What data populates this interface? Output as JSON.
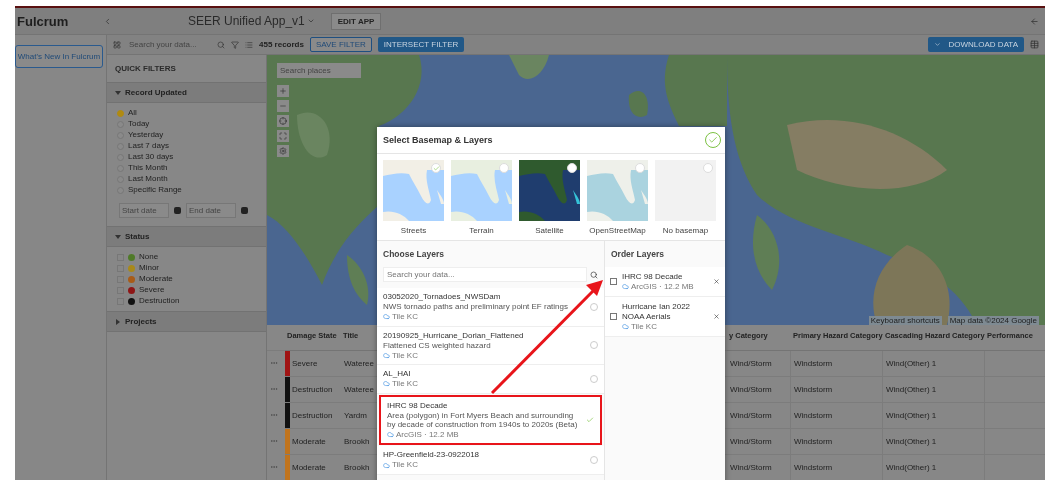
{
  "header": {
    "brand": "Fulcrum",
    "app_title": "SEER Unified App_v1",
    "edit_button": "EDIT APP"
  },
  "sidebar": {
    "whats_new_button": "What's New In Fulcrum"
  },
  "toolbar": {
    "search": {
      "placeholder": "Search your data..."
    },
    "record_count": "455 records",
    "save_filter_button": "SAVE FILTER",
    "intersect_button": "INTERSECT FILTER",
    "download_button": "DOWNLOAD DATA"
  },
  "filters": {
    "title": "QUICK FILTERS",
    "record_updated": {
      "title": "Record Updated",
      "expanded": true,
      "options": [
        {
          "label": "All",
          "selected": true
        },
        {
          "label": "Today",
          "selected": false
        },
        {
          "label": "Yesterday",
          "selected": false
        },
        {
          "label": "Last 7 days",
          "selected": false
        },
        {
          "label": "Last 30 days",
          "selected": false
        },
        {
          "label": "This Month",
          "selected": false
        },
        {
          "label": "Last Month",
          "selected": false
        },
        {
          "label": "Specific Range",
          "selected": false
        }
      ],
      "start": {
        "placeholder": "Start date"
      },
      "end": {
        "placeholder": "End date"
      }
    },
    "status": {
      "title": "Status",
      "expanded": true,
      "options": [
        {
          "label": "None",
          "color": "#4f7a28",
          "checked": false
        },
        {
          "label": "Minor",
          "color": "#a8891a",
          "checked": false
        },
        {
          "label": "Moderate",
          "color": "#a85c18",
          "checked": false
        },
        {
          "label": "Severe",
          "color": "#8e1616",
          "checked": false
        },
        {
          "label": "Destruction",
          "color": "#111111",
          "checked": false
        }
      ]
    },
    "projects": {
      "title": "Projects",
      "expanded": false
    }
  },
  "map": {
    "search": {
      "placeholder": "Search places"
    },
    "shortcuts": "Keyboard shortcuts",
    "attribution": "Map data ©2024 Google"
  },
  "table": {
    "columns": [
      "Damage State",
      "Title",
      "y Category",
      "Primary Hazard Category",
      "Cascading Hazard Category",
      "Performance"
    ],
    "rows": [
      {
        "damage": "Severe",
        "color": "#a01414",
        "title": "Wateree",
        "column_3": "Wind/Storm",
        "primary": "Windstorm",
        "cascading": "Wind(Other) 1"
      },
      {
        "damage": "Destruction",
        "color": "#111111",
        "title": "Wateree",
        "column_3": "Wind/Storm",
        "primary": "Windstorm",
        "cascading": "Wind(Other) 1"
      },
      {
        "damage": "Destruction",
        "color": "#111111",
        "title": "Yardm",
        "column_3": "Wind/Storm",
        "primary": "Windstorm",
        "cascading": "Wind(Other) 1"
      },
      {
        "damage": "Moderate",
        "color": "#c0741e",
        "title": "Brookh",
        "column_3": "Wind/Storm",
        "primary": "Windstorm",
        "cascading": "Wind(Other) 1"
      },
      {
        "damage": "Moderate",
        "color": "#c0741e",
        "title": "Brookh",
        "column_3": "Wind/Storm",
        "primary": "Windstorm",
        "cascading": "Wind(Other) 1"
      }
    ]
  },
  "modal": {
    "title": "Select Basemap & Layers",
    "basemaps": [
      {
        "label": "Streets",
        "kind": "streets",
        "selected": true
      },
      {
        "label": "Terrain",
        "kind": "terrain",
        "selected": false
      },
      {
        "label": "Satellite",
        "kind": "satellite",
        "selected": false
      },
      {
        "label": "OpenStreetMap",
        "kind": "osm",
        "selected": false
      },
      {
        "label": "No basemap",
        "kind": "none",
        "selected": false
      }
    ],
    "choose": {
      "title": "Choose Layers",
      "search": {
        "placeholder": "Search your data..."
      },
      "layers": [
        {
          "name": "03052020_Tornadoes_NWSDam",
          "description": "NWS tornado paths and preliminary point EF ratings",
          "source": "Tile KC",
          "selected": false,
          "highlighted": false
        },
        {
          "name": "20190925_Hurricane_Dorian_Flattened",
          "description": "Flattened CS weighted hazard",
          "source": "Tile KC",
          "selected": false,
          "highlighted": false
        },
        {
          "name": "AL_HAI",
          "source": "Tile KC",
          "selected": false,
          "highlighted": false
        },
        {
          "name": "IHRC 98 Decade",
          "description": "Area (polygon) in Fort Myers Beach and surrounding by decade of construction from 1940s to 2020s (Beta)",
          "source": "ArcGIS · 12.2 MB",
          "selected": true,
          "highlighted": true
        },
        {
          "name": "HP-Greenfield-23-0922018",
          "source": "Tile KC",
          "selected": false,
          "highlighted": false
        }
      ]
    },
    "order": {
      "title": "Order Layers",
      "layers": [
        {
          "name": "IHRC 98 Decade",
          "source": "ArcGIS · 12.2 MB",
          "checked": false
        },
        {
          "name": "Hurricane Ian 2022 NOAA Aerials",
          "source": "Tile KC",
          "checked": false
        }
      ]
    }
  }
}
